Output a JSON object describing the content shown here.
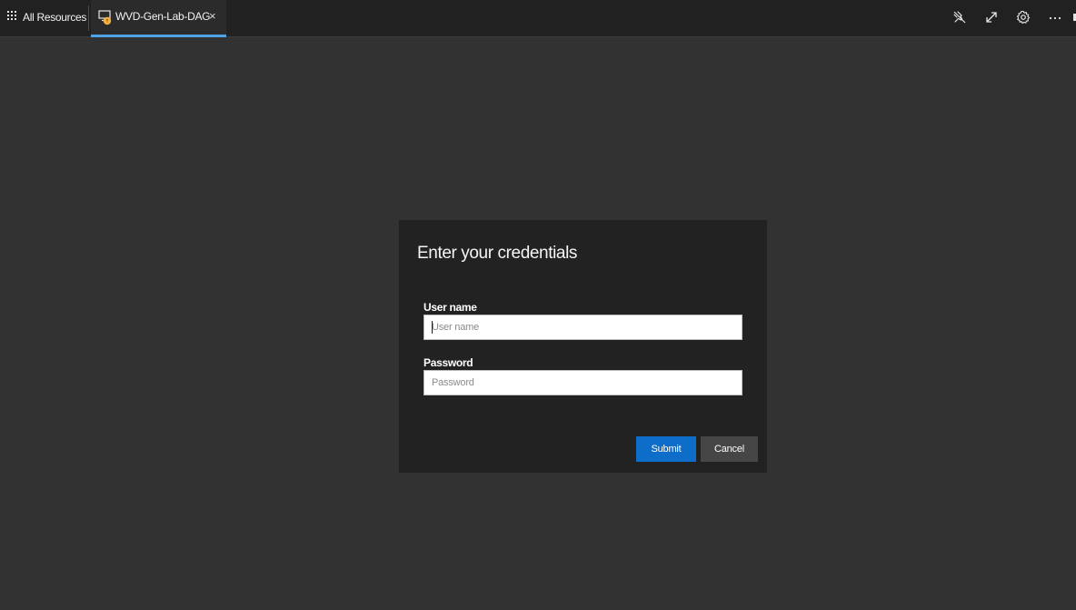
{
  "topbar": {
    "all_resources_label": "All Resources",
    "active_tab": {
      "title": "WVD-Gen-Lab-DAG",
      "close_glyph": "×",
      "badge_color": "#f2b33d"
    },
    "tab_underline_color": "#4da3e6",
    "actions": [
      {
        "icon": "unpin-icon"
      },
      {
        "icon": "expand-icon"
      },
      {
        "icon": "gear-icon"
      },
      {
        "icon": "more-icon"
      }
    ]
  },
  "dialog": {
    "title": "Enter your credentials",
    "username": {
      "label": "User name",
      "value": "",
      "placeholder": "User name"
    },
    "password": {
      "label": "Password",
      "value": "",
      "placeholder": "Password"
    },
    "submit_label": "Submit",
    "cancel_label": "Cancel",
    "submit_color": "#0e6dc8"
  }
}
